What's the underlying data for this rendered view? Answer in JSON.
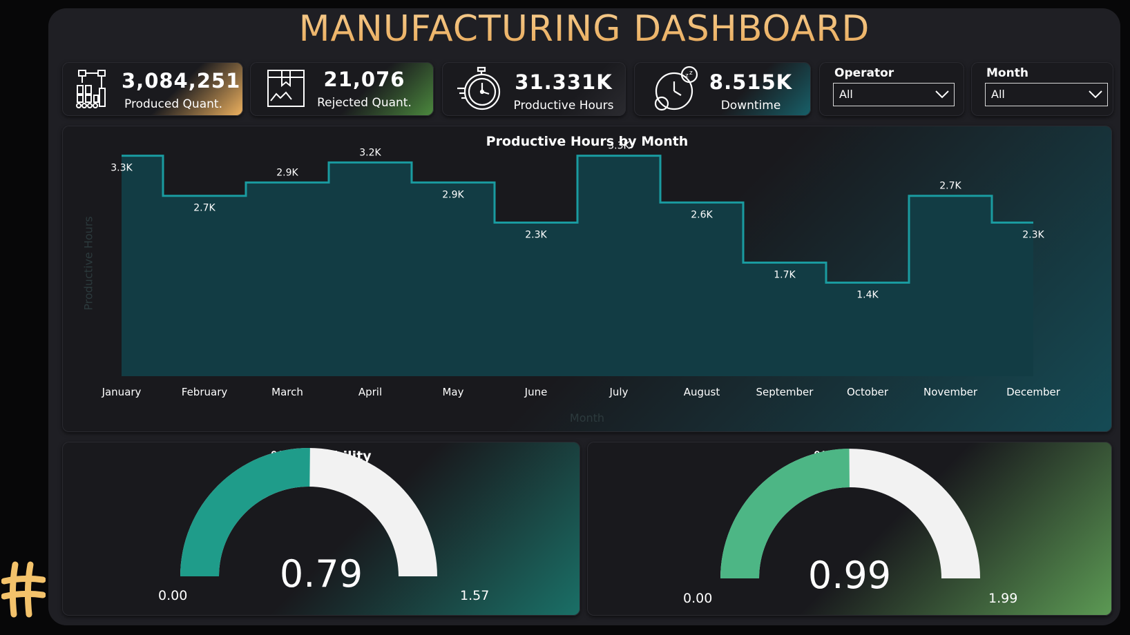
{
  "title": "MANUFACTURING DASHBOARD",
  "kpis": [
    {
      "value": "3,084,251",
      "label": "Produced Quant.",
      "icon": "robot-arm-icon"
    },
    {
      "value": "21,076",
      "label": "Rejected Quant.",
      "icon": "damaged-box-icon"
    },
    {
      "value": "31.331K",
      "label": "Productive Hours",
      "icon": "stopwatch-icon"
    },
    {
      "value": "8.515K",
      "label": "Downtime",
      "icon": "sleep-clock-icon"
    }
  ],
  "slicers": [
    {
      "title": "Operator",
      "value": "All"
    },
    {
      "title": "Month",
      "value": "All"
    }
  ],
  "chart_data": {
    "type": "area",
    "title": "Productive Hours by Month",
    "xlabel": "Month",
    "ylabel": "Productive Hours",
    "categories": [
      "January",
      "February",
      "March",
      "April",
      "May",
      "June",
      "July",
      "August",
      "September",
      "October",
      "November",
      "December"
    ],
    "values": [
      3300,
      2700,
      2900,
      3200,
      2900,
      2300,
      3300,
      2600,
      1700,
      1400,
      2700,
      2300
    ],
    "data_labels": [
      "3.3K",
      "2.7K",
      "2.9K",
      "3.2K",
      "2.9K",
      "2.3K",
      "3.3K",
      "2.6K",
      "1.7K",
      "1.4K",
      "2.7K",
      "2.3K"
    ],
    "ylim": [
      0,
      3400
    ],
    "line_color": "#1a9ba0",
    "fill_color": "#123c44"
  },
  "gauges": [
    {
      "title": "% Availability",
      "value": 0.79,
      "value_label": "0.79",
      "min": "0.00",
      "max": "1.57",
      "fill_color": "#1f9c8a",
      "track_color": "#f2f2f2"
    },
    {
      "title": "% Quality",
      "value": 0.99,
      "value_label": "0.99",
      "min": "0.00",
      "max": "1.99",
      "fill_color": "#4db685",
      "track_color": "#f2f2f2"
    }
  ],
  "logo": {
    "icon": "hashtag-logo-icon",
    "color": "#f3c26b"
  }
}
